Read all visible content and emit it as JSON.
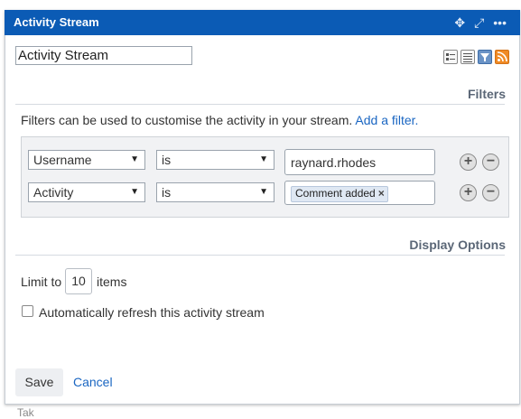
{
  "window": {
    "title": "Activity Stream"
  },
  "header_icons": [
    "move-icon",
    "expand-icon",
    "more-icon"
  ],
  "stream_title_value": "Activity Stream",
  "view_icons": [
    "list-view-icon",
    "detail-view-icon",
    "filter-view-icon",
    "rss-icon"
  ],
  "filters": {
    "section_title": "Filters",
    "help_text": "Filters can be used to customise the activity in your stream.",
    "add_filter_link": "Add a filter.",
    "rows": [
      {
        "field": "Username",
        "operator": "is",
        "value": "raynard.rhodes"
      },
      {
        "field": "Activity",
        "operator": "is",
        "chip": "Comment added"
      }
    ]
  },
  "display_options": {
    "section_title": "Display Options",
    "limit_prefix": "Limit to",
    "limit_value": "10",
    "limit_suffix": "items",
    "auto_refresh_label": "Automatically refresh this activity stream",
    "auto_refresh_checked": false
  },
  "actions": {
    "save_label": "Save",
    "cancel_label": "Cancel"
  },
  "bottom_partial_text": "Tak",
  "colors": {
    "header_bg": "#0b5bb5",
    "link": "#1a66c2",
    "section_title": "#5b6777"
  }
}
